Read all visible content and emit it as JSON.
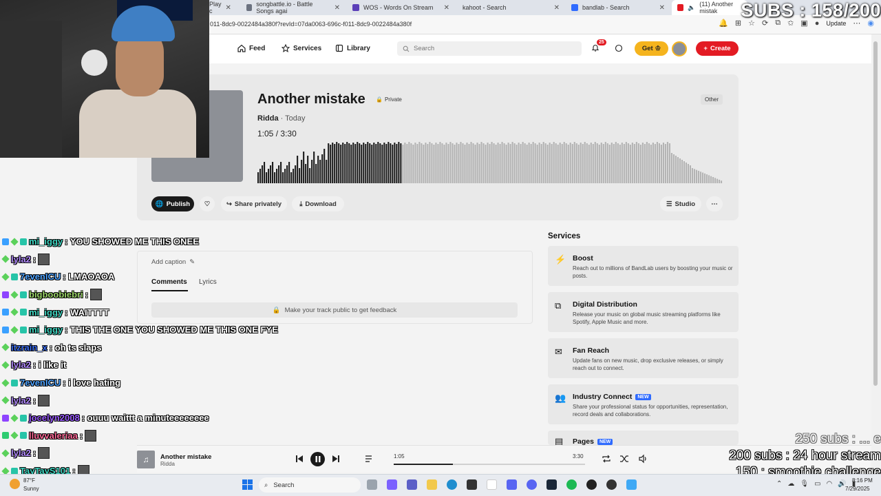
{
  "browser": {
    "tabs": [
      {
        "label": "Play c"
      },
      {
        "label": "songbattle.io - Battle Songs agai"
      },
      {
        "label": "WOS - Words On Stream"
      },
      {
        "label": "kahoot - Search"
      },
      {
        "label": "bandlab - Search"
      },
      {
        "label": "(11) Another mistak"
      }
    ],
    "url": "011-8dc9-0022484a380f?revId=07da0063-696c-f011-8dc9-0022484a380f",
    "update_label": "Update"
  },
  "overlay": {
    "subs_counter": "SUBS : 158/200",
    "goals": [
      "250 subs : ... e",
      "200 subs : 24 hour stream",
      "150 : smoothie challenge"
    ]
  },
  "nav": {
    "feed": "Feed",
    "services": "Services",
    "library": "Library",
    "search_placeholder": "Search",
    "notif_count": "25",
    "get_label": "Get",
    "create_label": "Create"
  },
  "track": {
    "title": "Another mistake",
    "privacy": "Private",
    "genre": "Other",
    "artist": "Ridda",
    "date": "Today",
    "current_time": "1:05",
    "total_time": "3:30",
    "progress": 0.31
  },
  "actions": {
    "publish": "Publish",
    "share": "Share privately",
    "download": "Download",
    "studio": "Studio"
  },
  "comments": {
    "add_caption": "Add caption",
    "tab_comments": "Comments",
    "tab_lyrics": "Lyrics",
    "public_note": "Make your track public to get feedback"
  },
  "services": {
    "heading": "Services",
    "items": [
      {
        "title": "Boost",
        "desc": "Reach out to millions of BandLab users by boosting your music or posts.",
        "is_new": false,
        "icon": "bolt-icon"
      },
      {
        "title": "Digital Distribution",
        "desc": "Release your music on global music streaming platforms like Spotify, Apple Music and more.",
        "is_new": false,
        "icon": "distribution-icon"
      },
      {
        "title": "Fan Reach",
        "desc": "Update fans on new music, drop exclusive releases, or simply reach out to connect.",
        "is_new": false,
        "icon": "mail-icon"
      },
      {
        "title": "Industry Connect",
        "desc": "Share your professional status for opportunities, representation, record deals and collaborations.",
        "is_new": true,
        "icon": "people-icon"
      },
      {
        "title": "Pages",
        "desc": "",
        "is_new": true,
        "icon": "pages-icon"
      }
    ],
    "new_label": "NEW"
  },
  "player": {
    "title": "Another mistake",
    "artist": "Ridda",
    "current": "1:05",
    "total": "3:30"
  },
  "chat": [
    {
      "user": "mi_iggy",
      "color": "#3fd6c2",
      "msg": ": YOU SHOWED ME THIS ONEE",
      "badges": [
        "cube",
        "gem",
        "sub"
      ]
    },
    {
      "user": "lyla2",
      "color": "#b48cff",
      "msg": ":",
      "badges": [
        "gem"
      ],
      "emote": true
    },
    {
      "user": "7evenICU",
      "color": "#4fa3ff",
      "msg": ": LMAOAOA",
      "badges": [
        "gem",
        "sub"
      ]
    },
    {
      "user": "bigboobiebri",
      "color": "#9dd66b",
      "msg": ":",
      "badges": [
        "purple",
        "gem",
        "sub"
      ],
      "emote": true
    },
    {
      "user": "mi_iggy",
      "color": "#3fd6c2",
      "msg": ": WAITTTT",
      "badges": [
        "cube",
        "gem",
        "sub"
      ]
    },
    {
      "user": "mi_iggy",
      "color": "#3fd6c2",
      "msg": ": THIS THE ONE YOU SHOWED ME THIS ONE FYE",
      "badges": [
        "cube",
        "gem",
        "sub"
      ]
    },
    {
      "user": "itzrain_x",
      "color": "#3a6cf0",
      "msg": ": oh ts slaps",
      "badges": [
        "gem"
      ]
    },
    {
      "user": "lyla2",
      "color": "#b48cff",
      "msg": ": i like it",
      "badges": [
        "gem"
      ]
    },
    {
      "user": "7evenICU",
      "color": "#4fa3ff",
      "msg": ": i love hating",
      "badges": [
        "gem",
        "sub"
      ]
    },
    {
      "user": "lyla2",
      "color": "#b48cff",
      "msg": ":",
      "badges": [
        "gem"
      ],
      "emote": true
    },
    {
      "user": "jocelyn2008",
      "color": "#9b5cff",
      "msg": ": ouuu waittt a minuteeeeeeee",
      "badges": [
        "purple",
        "gem",
        "sub"
      ]
    },
    {
      "user": "lluvvaleriaa",
      "color": "#ff6b9a",
      "msg": ":",
      "badges": [
        "green",
        "gem",
        "sub"
      ],
      "emote": true
    },
    {
      "user": "lyla2",
      "color": "#b48cff",
      "msg": ":",
      "badges": [
        "gem"
      ],
      "emote": true
    },
    {
      "user": "TayTayS101",
      "color": "#3fd6c2",
      "msg": ":",
      "badges": [
        "gem",
        "sub"
      ],
      "emote": true
    }
  ],
  "taskbar": {
    "temp": "87°F",
    "condition": "Sunny",
    "search_label": "Search",
    "time": "8:16 PM",
    "date": "7/29/2025"
  },
  "colors": {
    "accent_red": "#e31b23",
    "get_yellow": "#f5b41e",
    "new_blue": "#2f6bff"
  }
}
